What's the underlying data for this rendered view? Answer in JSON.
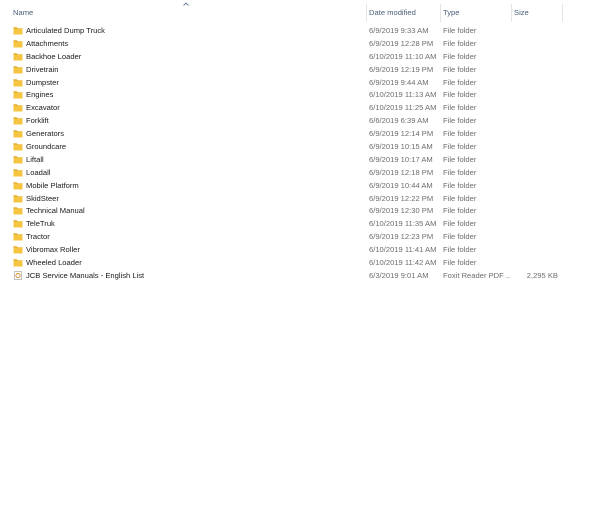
{
  "columns": {
    "name": "Name",
    "date_modified": "Date modified",
    "type": "Type",
    "size": "Size"
  },
  "sort": {
    "column": "name",
    "direction": "ascending",
    "icon": "chevron-up-icon"
  },
  "colors": {
    "folder": "#f5c542",
    "folder_dark": "#e0a92b",
    "header_text": "#4c607a",
    "secondary_text": "#6d6d6d"
  },
  "items": [
    {
      "name": "Articulated Dump Truck",
      "date": "6/9/2019 9:33 AM",
      "type": "File folder",
      "size": "",
      "icon": "folder-icon"
    },
    {
      "name": "Attachments",
      "date": "6/9/2019 12:28 PM",
      "type": "File folder",
      "size": "",
      "icon": "folder-icon"
    },
    {
      "name": "Backhoe Loader",
      "date": "6/10/2019 11:10 AM",
      "type": "File folder",
      "size": "",
      "icon": "folder-icon"
    },
    {
      "name": "Drivetrain",
      "date": "6/9/2019 12:19 PM",
      "type": "File folder",
      "size": "",
      "icon": "folder-icon"
    },
    {
      "name": "Dumpster",
      "date": "6/9/2019 9:44 AM",
      "type": "File folder",
      "size": "",
      "icon": "folder-icon"
    },
    {
      "name": "Engines",
      "date": "6/10/2019 11:13 AM",
      "type": "File folder",
      "size": "",
      "icon": "folder-icon"
    },
    {
      "name": "Excavator",
      "date": "6/10/2019 11:25 AM",
      "type": "File folder",
      "size": "",
      "icon": "folder-icon"
    },
    {
      "name": "Forklift",
      "date": "6/6/2019 6:39 AM",
      "type": "File folder",
      "size": "",
      "icon": "folder-icon"
    },
    {
      "name": "Generators",
      "date": "6/9/2019 12:14 PM",
      "type": "File folder",
      "size": "",
      "icon": "folder-icon"
    },
    {
      "name": "Groundcare",
      "date": "6/9/2019 10:15 AM",
      "type": "File folder",
      "size": "",
      "icon": "folder-icon"
    },
    {
      "name": "Liftall",
      "date": "6/9/2019 10:17 AM",
      "type": "File folder",
      "size": "",
      "icon": "folder-icon"
    },
    {
      "name": "Loadall",
      "date": "6/9/2019 12:18 PM",
      "type": "File folder",
      "size": "",
      "icon": "folder-icon"
    },
    {
      "name": "Mobile Platform",
      "date": "6/9/2019 10:44 AM",
      "type": "File folder",
      "size": "",
      "icon": "folder-icon"
    },
    {
      "name": "SkidSteer",
      "date": "6/9/2019 12:22 PM",
      "type": "File folder",
      "size": "",
      "icon": "folder-icon"
    },
    {
      "name": "Technical Manual",
      "date": "6/9/2019 12:30 PM",
      "type": "File folder",
      "size": "",
      "icon": "folder-icon"
    },
    {
      "name": "TeleTruk",
      "date": "6/10/2019 11:35 AM",
      "type": "File folder",
      "size": "",
      "icon": "folder-icon"
    },
    {
      "name": "Tractor",
      "date": "6/9/2019 12:23 PM",
      "type": "File folder",
      "size": "",
      "icon": "folder-icon"
    },
    {
      "name": "Vibromax Roller",
      "date": "6/10/2019 11:41 AM",
      "type": "File folder",
      "size": "",
      "icon": "folder-icon"
    },
    {
      "name": "Wheeled Loader",
      "date": "6/10/2019 11:42 AM",
      "type": "File folder",
      "size": "",
      "icon": "folder-icon"
    },
    {
      "name": "JCB Service Manuals - English List",
      "date": "6/3/2019 9:01 AM",
      "type": "Foxit Reader PDF ...",
      "size": "2,295 KB",
      "icon": "pdf-file-icon"
    }
  ]
}
